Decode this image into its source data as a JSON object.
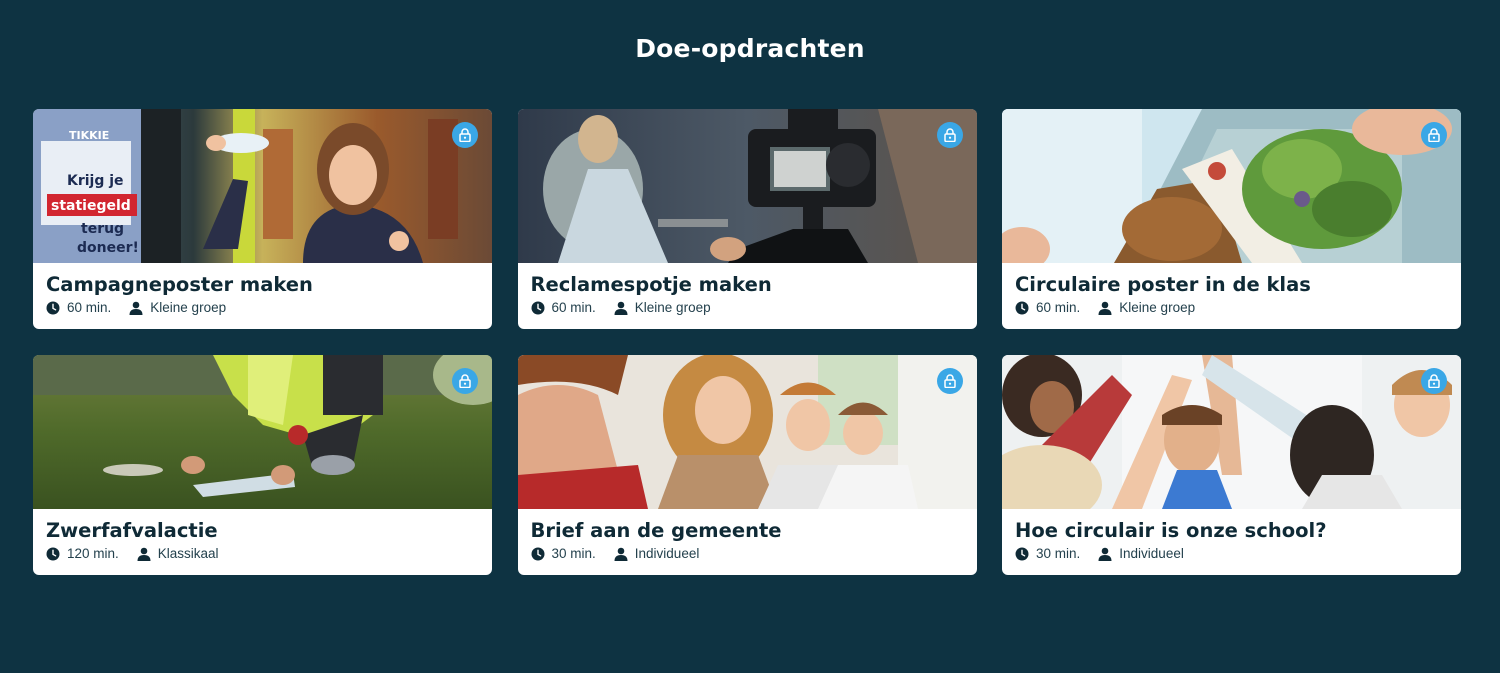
{
  "page": {
    "title": "Doe-opdrachten"
  },
  "colors": {
    "background": "#0e3342",
    "card": "#ffffff",
    "lock_badge": "#3aa7e6",
    "text": "#0f2a36"
  },
  "cards": [
    {
      "title": "Campagneposter maken",
      "duration": "60 min.",
      "group": "Kleine groep",
      "image": "girl-with-bottle-recycling-machine",
      "locked": true,
      "photo_text": [
        "TIKKIE",
        "Krijg je",
        "statiegeld",
        "terug",
        "doneer!"
      ]
    },
    {
      "title": "Reclamespotje maken",
      "duration": "60 min.",
      "group": "Kleine groep",
      "image": "camera-on-tripod",
      "locked": true
    },
    {
      "title": "Circulaire poster in de klas",
      "duration": "60 min.",
      "group": "Kleine groep",
      "image": "lunchbox-with-salad",
      "locked": true
    },
    {
      "title": "Zwerfafvalactie",
      "duration": "120 min.",
      "group": "Klassikaal",
      "image": "picking-up-litter",
      "locked": true
    },
    {
      "title": "Brief aan de gemeente",
      "duration": "30 min.",
      "group": "Individueel",
      "image": "students-writing",
      "locked": true
    },
    {
      "title": "Hoe circulair is onze school?",
      "duration": "30 min.",
      "group": "Individueel",
      "image": "kids-high-five",
      "locked": true
    }
  ],
  "icons": {
    "lock": "lock-icon",
    "duration": "clock-icon",
    "group": "person-icon"
  }
}
